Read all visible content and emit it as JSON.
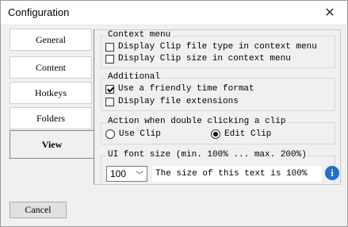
{
  "window": {
    "title": "Configuration",
    "close_glyph": "✕"
  },
  "sidebar": {
    "items": [
      {
        "label": "General"
      },
      {
        "label": "Content"
      },
      {
        "label": "Hotkeys"
      },
      {
        "label": "Folders"
      },
      {
        "label": "View",
        "active": true
      }
    ]
  },
  "context_menu": {
    "legend": "Context menu",
    "options": [
      {
        "label": "Display Clip file type in context menu",
        "checked": false
      },
      {
        "label": "Display Clip size in context menu",
        "checked": false
      }
    ]
  },
  "additional": {
    "legend": "Additional",
    "options": [
      {
        "label": "Use a friendly time format",
        "checked": true
      },
      {
        "label": "Display file extensions",
        "checked": false
      }
    ]
  },
  "double_click": {
    "legend": "Action when double clicking a clip",
    "options": [
      {
        "label": "Use Clip",
        "selected": false
      },
      {
        "label": "Edit Clip",
        "selected": true
      }
    ]
  },
  "font_size": {
    "legend": "UI font size (min. 100% ... max. 200%)",
    "value": "100",
    "sample_text": "The size of this text is 100%",
    "icon": "info-icon"
  },
  "footer": {
    "cancel_label": "Cancel"
  }
}
